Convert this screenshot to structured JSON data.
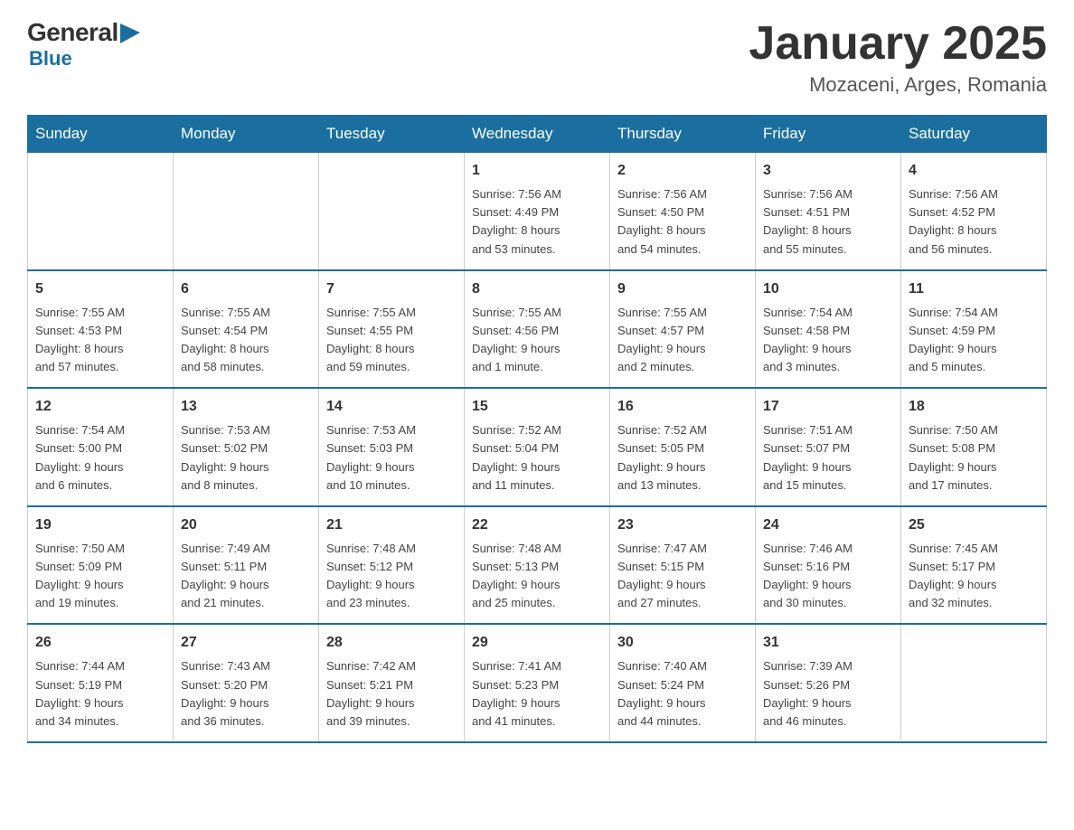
{
  "logo": {
    "general": "General",
    "blue": "Blue",
    "arrow": "▶"
  },
  "header": {
    "month": "January 2025",
    "location": "Mozaceni, Arges, Romania"
  },
  "days_of_week": [
    "Sunday",
    "Monday",
    "Tuesday",
    "Wednesday",
    "Thursday",
    "Friday",
    "Saturday"
  ],
  "weeks": [
    [
      {
        "day": "",
        "info": ""
      },
      {
        "day": "",
        "info": ""
      },
      {
        "day": "",
        "info": ""
      },
      {
        "day": "1",
        "info": "Sunrise: 7:56 AM\nSunset: 4:49 PM\nDaylight: 8 hours\nand 53 minutes."
      },
      {
        "day": "2",
        "info": "Sunrise: 7:56 AM\nSunset: 4:50 PM\nDaylight: 8 hours\nand 54 minutes."
      },
      {
        "day": "3",
        "info": "Sunrise: 7:56 AM\nSunset: 4:51 PM\nDaylight: 8 hours\nand 55 minutes."
      },
      {
        "day": "4",
        "info": "Sunrise: 7:56 AM\nSunset: 4:52 PM\nDaylight: 8 hours\nand 56 minutes."
      }
    ],
    [
      {
        "day": "5",
        "info": "Sunrise: 7:55 AM\nSunset: 4:53 PM\nDaylight: 8 hours\nand 57 minutes."
      },
      {
        "day": "6",
        "info": "Sunrise: 7:55 AM\nSunset: 4:54 PM\nDaylight: 8 hours\nand 58 minutes."
      },
      {
        "day": "7",
        "info": "Sunrise: 7:55 AM\nSunset: 4:55 PM\nDaylight: 8 hours\nand 59 minutes."
      },
      {
        "day": "8",
        "info": "Sunrise: 7:55 AM\nSunset: 4:56 PM\nDaylight: 9 hours\nand 1 minute."
      },
      {
        "day": "9",
        "info": "Sunrise: 7:55 AM\nSunset: 4:57 PM\nDaylight: 9 hours\nand 2 minutes."
      },
      {
        "day": "10",
        "info": "Sunrise: 7:54 AM\nSunset: 4:58 PM\nDaylight: 9 hours\nand 3 minutes."
      },
      {
        "day": "11",
        "info": "Sunrise: 7:54 AM\nSunset: 4:59 PM\nDaylight: 9 hours\nand 5 minutes."
      }
    ],
    [
      {
        "day": "12",
        "info": "Sunrise: 7:54 AM\nSunset: 5:00 PM\nDaylight: 9 hours\nand 6 minutes."
      },
      {
        "day": "13",
        "info": "Sunrise: 7:53 AM\nSunset: 5:02 PM\nDaylight: 9 hours\nand 8 minutes."
      },
      {
        "day": "14",
        "info": "Sunrise: 7:53 AM\nSunset: 5:03 PM\nDaylight: 9 hours\nand 10 minutes."
      },
      {
        "day": "15",
        "info": "Sunrise: 7:52 AM\nSunset: 5:04 PM\nDaylight: 9 hours\nand 11 minutes."
      },
      {
        "day": "16",
        "info": "Sunrise: 7:52 AM\nSunset: 5:05 PM\nDaylight: 9 hours\nand 13 minutes."
      },
      {
        "day": "17",
        "info": "Sunrise: 7:51 AM\nSunset: 5:07 PM\nDaylight: 9 hours\nand 15 minutes."
      },
      {
        "day": "18",
        "info": "Sunrise: 7:50 AM\nSunset: 5:08 PM\nDaylight: 9 hours\nand 17 minutes."
      }
    ],
    [
      {
        "day": "19",
        "info": "Sunrise: 7:50 AM\nSunset: 5:09 PM\nDaylight: 9 hours\nand 19 minutes."
      },
      {
        "day": "20",
        "info": "Sunrise: 7:49 AM\nSunset: 5:11 PM\nDaylight: 9 hours\nand 21 minutes."
      },
      {
        "day": "21",
        "info": "Sunrise: 7:48 AM\nSunset: 5:12 PM\nDaylight: 9 hours\nand 23 minutes."
      },
      {
        "day": "22",
        "info": "Sunrise: 7:48 AM\nSunset: 5:13 PM\nDaylight: 9 hours\nand 25 minutes."
      },
      {
        "day": "23",
        "info": "Sunrise: 7:47 AM\nSunset: 5:15 PM\nDaylight: 9 hours\nand 27 minutes."
      },
      {
        "day": "24",
        "info": "Sunrise: 7:46 AM\nSunset: 5:16 PM\nDaylight: 9 hours\nand 30 minutes."
      },
      {
        "day": "25",
        "info": "Sunrise: 7:45 AM\nSunset: 5:17 PM\nDaylight: 9 hours\nand 32 minutes."
      }
    ],
    [
      {
        "day": "26",
        "info": "Sunrise: 7:44 AM\nSunset: 5:19 PM\nDaylight: 9 hours\nand 34 minutes."
      },
      {
        "day": "27",
        "info": "Sunrise: 7:43 AM\nSunset: 5:20 PM\nDaylight: 9 hours\nand 36 minutes."
      },
      {
        "day": "28",
        "info": "Sunrise: 7:42 AM\nSunset: 5:21 PM\nDaylight: 9 hours\nand 39 minutes."
      },
      {
        "day": "29",
        "info": "Sunrise: 7:41 AM\nSunset: 5:23 PM\nDaylight: 9 hours\nand 41 minutes."
      },
      {
        "day": "30",
        "info": "Sunrise: 7:40 AM\nSunset: 5:24 PM\nDaylight: 9 hours\nand 44 minutes."
      },
      {
        "day": "31",
        "info": "Sunrise: 7:39 AM\nSunset: 5:26 PM\nDaylight: 9 hours\nand 46 minutes."
      },
      {
        "day": "",
        "info": ""
      }
    ]
  ]
}
